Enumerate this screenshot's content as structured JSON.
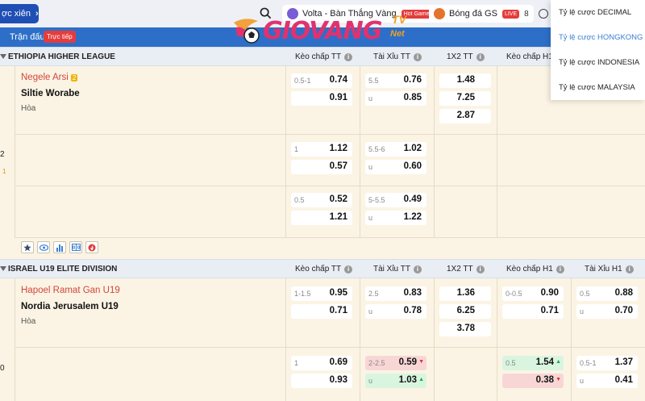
{
  "topbar": {
    "parlay_label": "ợc xiên",
    "tabs": [
      {
        "label": "Volta - Bàn Thắng Vàng",
        "badge": "Hot Game"
      },
      {
        "label": "Bóng đá GS",
        "badge": "LIVE",
        "count": "8"
      }
    ]
  },
  "logo": {
    "main": "GIOVANG",
    "tv": "TV",
    "net": "Net"
  },
  "subbar": {
    "matches": "Trận đấu",
    "live": "Trực tiếp"
  },
  "dropdown": {
    "items": [
      "Tỷ lệ cược DECIMAL",
      "Tỷ lệ cược HONGKONG",
      "Tỷ lệ cược INDONESIA",
      "Tỷ lệ cược MALAYSIA"
    ],
    "active_index": 1
  },
  "columns": {
    "hcp_ft": "Kèo chấp TT",
    "ou_ft": "Tài Xỉu TT",
    "x12_ft": "1X2 TT",
    "hcp_h1": "Kèo chấp H1",
    "ou_h1": "Tài Xỉu H1"
  },
  "leagues": [
    {
      "name": "ETHIOPIA HIGHER LEAGUE",
      "match": {
        "home": "Negele Arsi",
        "home_rank": "2",
        "away": "Siltie Worabe",
        "draw": "Hòa",
        "side_score": "2",
        "side_small": "1",
        "rows": [
          {
            "hcp": "0.5-1",
            "hcp_home": "0.74",
            "hcp_away": "0.91",
            "ou": "5.5",
            "ou_over": "0.76",
            "ou_under_label": "u",
            "ou_under": "0.85",
            "x1": "1.48",
            "x2": "7.25",
            "xd": "2.87"
          },
          {
            "hcp": "1",
            "hcp_home": "1.12",
            "hcp_away": "0.57",
            "ou": "5.5-6",
            "ou_over": "1.02",
            "ou_under_label": "u",
            "ou_under": "0.60"
          },
          {
            "hcp": "0.5",
            "hcp_home": "0.52",
            "hcp_away": "1.21",
            "ou": "5-5.5",
            "ou_over": "0.49",
            "ou_under_label": "u",
            "ou_under": "1.22"
          }
        ]
      }
    },
    {
      "name": "ISRAEL U19 ELITE DIVISION",
      "match": {
        "home": "Hapoel Ramat Gan U19",
        "away": "Nordia Jerusalem U19",
        "draw": "Hòa",
        "side_score": "0",
        "rows": [
          {
            "hcp": "1-1.5",
            "hcp_home": "0.95",
            "hcp_away": "0.71",
            "ou": "2.5",
            "ou_over": "0.83",
            "ou_under_label": "u",
            "ou_under": "0.78",
            "x1": "1.36",
            "x2": "6.25",
            "xd": "3.78",
            "h1_hcp": "0-0.5",
            "h1_home": "0.90",
            "h1_away": "0.71",
            "h1_ou": "0.5",
            "h1_over": "0.88",
            "h1_under_label": "u",
            "h1_under": "0.70"
          },
          {
            "hcp": "1",
            "hcp_home": "0.69",
            "hcp_away": "0.93",
            "ou": "2-2.5",
            "ou_over": "0.59",
            "ou_under_label": "u",
            "ou_under": "1.03",
            "h1_hcp": "0.5",
            "h1_home": "1.54",
            "h1_away": "0.38",
            "h1_ou": "0.5-1",
            "h1_over": "1.37",
            "h1_under_label": "u",
            "h1_under": "0.41"
          }
        ]
      }
    }
  ],
  "colors": {
    "primary_blue": "#2d6fc8",
    "live_red": "#e43c3c",
    "home_team_red": "#d0463c",
    "up_green": "#d9f5e0",
    "down_red": "#f9d6d6"
  }
}
